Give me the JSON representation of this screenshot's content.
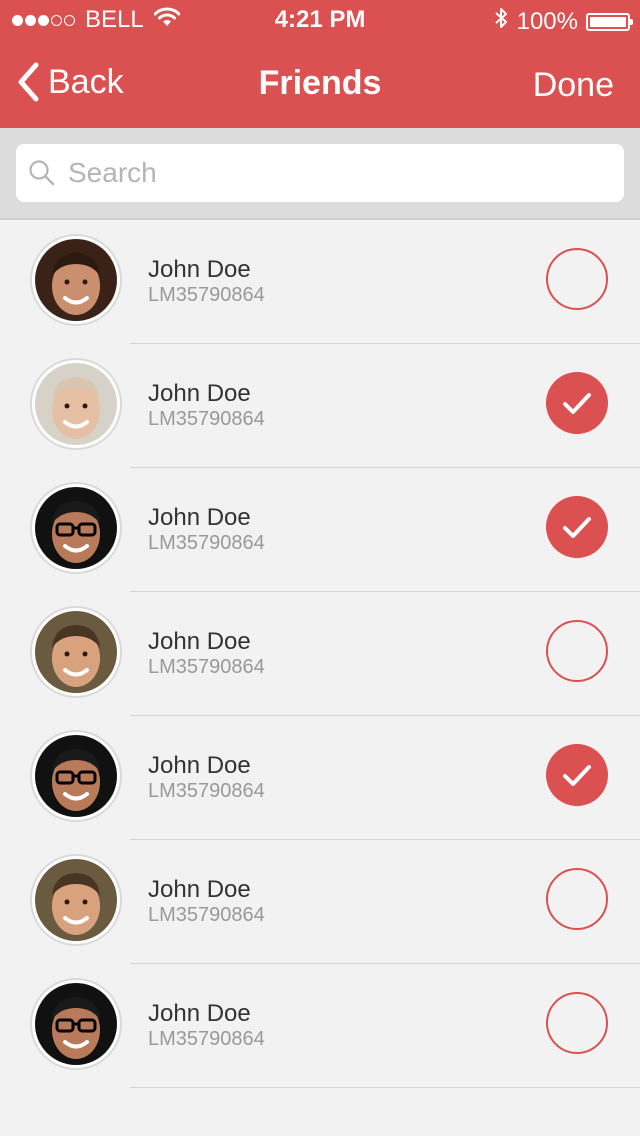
{
  "status_bar": {
    "carrier": "BELL",
    "time": "4:21 PM",
    "battery": "100%",
    "signal_bars": 3,
    "signal_total": 5
  },
  "nav": {
    "back_label": "Back",
    "title": "Friends",
    "done_label": "Done"
  },
  "search": {
    "placeholder": "Search"
  },
  "colors": {
    "accent": "#db5050",
    "background": "#f2f2f2",
    "search_bar": "#dcdcdc"
  },
  "friends": [
    {
      "name": "John Doe",
      "id": "LM35790864",
      "selected": false
    },
    {
      "name": "John Doe",
      "id": "LM35790864",
      "selected": true
    },
    {
      "name": "John Doe",
      "id": "LM35790864",
      "selected": true
    },
    {
      "name": "John Doe",
      "id": "LM35790864",
      "selected": false
    },
    {
      "name": "John Doe",
      "id": "LM35790864",
      "selected": true
    },
    {
      "name": "John Doe",
      "id": "LM35790864",
      "selected": false
    },
    {
      "name": "John Doe",
      "id": "LM35790864",
      "selected": false
    }
  ]
}
